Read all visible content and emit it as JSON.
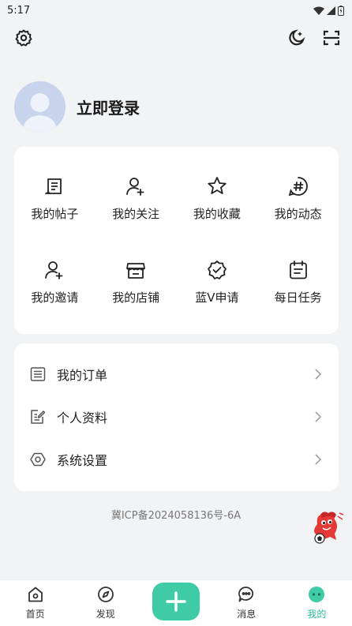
{
  "status_bar": {
    "time": "5:17"
  },
  "profile": {
    "login_label": "立即登录"
  },
  "features": [
    {
      "icon": "post-icon",
      "label": "我的帖子"
    },
    {
      "icon": "follow-icon",
      "label": "我的关注"
    },
    {
      "icon": "star-icon",
      "label": "我的收藏"
    },
    {
      "icon": "hashtag-icon",
      "label": "我的动态"
    },
    {
      "icon": "invite-icon",
      "label": "我的邀请"
    },
    {
      "icon": "store-icon",
      "label": "我的店铺"
    },
    {
      "icon": "verified-badge-icon",
      "label": "蓝V申请"
    },
    {
      "icon": "calendar-icon",
      "label": "每日任务"
    }
  ],
  "menu": [
    {
      "icon": "order-list-icon",
      "label": "我的订单"
    },
    {
      "icon": "profile-edit-icon",
      "label": "个人资料"
    },
    {
      "icon": "hexagon-settings-icon",
      "label": "系统设置"
    }
  ],
  "footer": {
    "icp": "冀ICP备2024058136号-6A"
  },
  "tabs": [
    {
      "icon": "home-icon",
      "label": "首页"
    },
    {
      "icon": "compass-icon",
      "label": "发现"
    },
    {
      "icon": "plus-icon",
      "label": ""
    },
    {
      "icon": "chat-icon",
      "label": "消息"
    },
    {
      "icon": "mine-icon",
      "label": "我的",
      "active": true
    }
  ],
  "colors": {
    "accent": "#3ecba6",
    "active_tab_text": "#2bbd9a",
    "background": "#f2f3f5"
  }
}
